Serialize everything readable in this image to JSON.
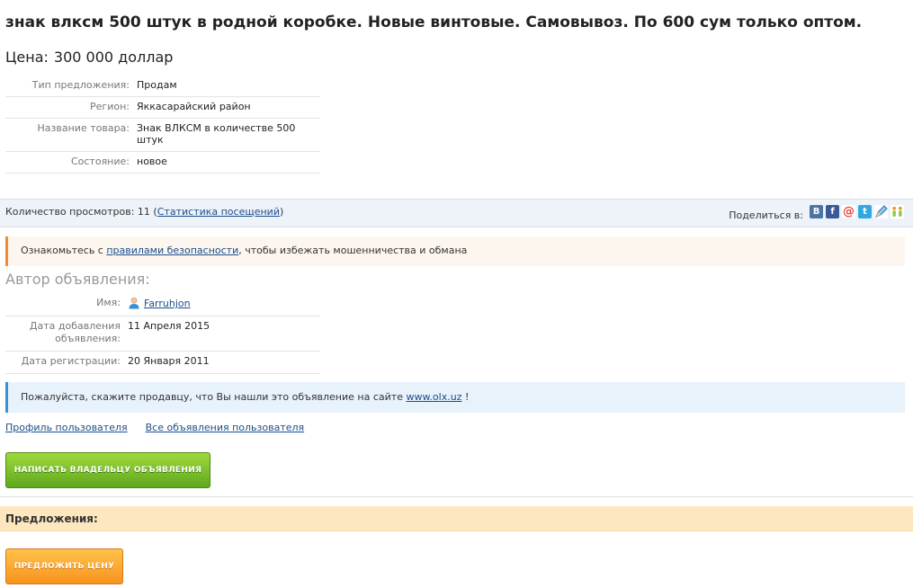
{
  "ad": {
    "title": "знак влксм 500 штук в родной коробке. Новые винтовые. Самовывоз. По 600 сум только оптом.",
    "price_label": "Цена:",
    "price_value": "300 000 доллар"
  },
  "params": [
    {
      "key": "Тип предложения:",
      "value": "Продам"
    },
    {
      "key": "Регион:",
      "value": "Яккасарайский район"
    },
    {
      "key": "Название товара:",
      "value": "Знак ВЛКСМ в количестве 500 штук"
    },
    {
      "key": "Состояние:",
      "value": "новое"
    }
  ],
  "views": {
    "prefix": "Количество просмотров: 11 (",
    "stats_link": "Статистика посещений",
    "suffix": ")"
  },
  "share": {
    "label": "Поделиться в:",
    "icons": [
      "vk-icon",
      "facebook-icon",
      "mail-icon",
      "twitter-icon",
      "livejournal-icon",
      "odnoklassniki-icon"
    ]
  },
  "safety": {
    "prefix": "Ознакомьтесь с ",
    "link": "правилами безопасности",
    "suffix": ", чтобы избежать мошенничества и обмана"
  },
  "author": {
    "title": "Автор объявления:",
    "name_label": "Имя:",
    "name": "Farruhjon",
    "added_label": "Дата добавления объявления:",
    "added": "11 Апреля 2015",
    "registered_label": "Дата регистрации:",
    "registered": "20 Января 2011"
  },
  "notice": {
    "prefix": "Пожалуйста, скажите продавцу, что Вы нашли это объявление на сайте ",
    "link": "www.olx.uz",
    "suffix": " !"
  },
  "links": {
    "profile": "Профиль пользователя",
    "all_ads": "Все объявления пользователя"
  },
  "buttons": {
    "write_owner": "НАПИСАТЬ ВЛАДЕЛЬЦУ ОБЪЯВЛЕНИЯ",
    "offer_price": "ПРЕДЛОЖИТЬ ЦЕНУ"
  },
  "offers": {
    "title": "Предложения:"
  },
  "colors": {
    "link": "#1a4e8c",
    "green_button": "#6cb523",
    "orange_button": "#f7931e",
    "safety_accent": "#f08c2e",
    "notice_accent": "#3b8fd6",
    "offers_bg": "#fde7bf"
  }
}
